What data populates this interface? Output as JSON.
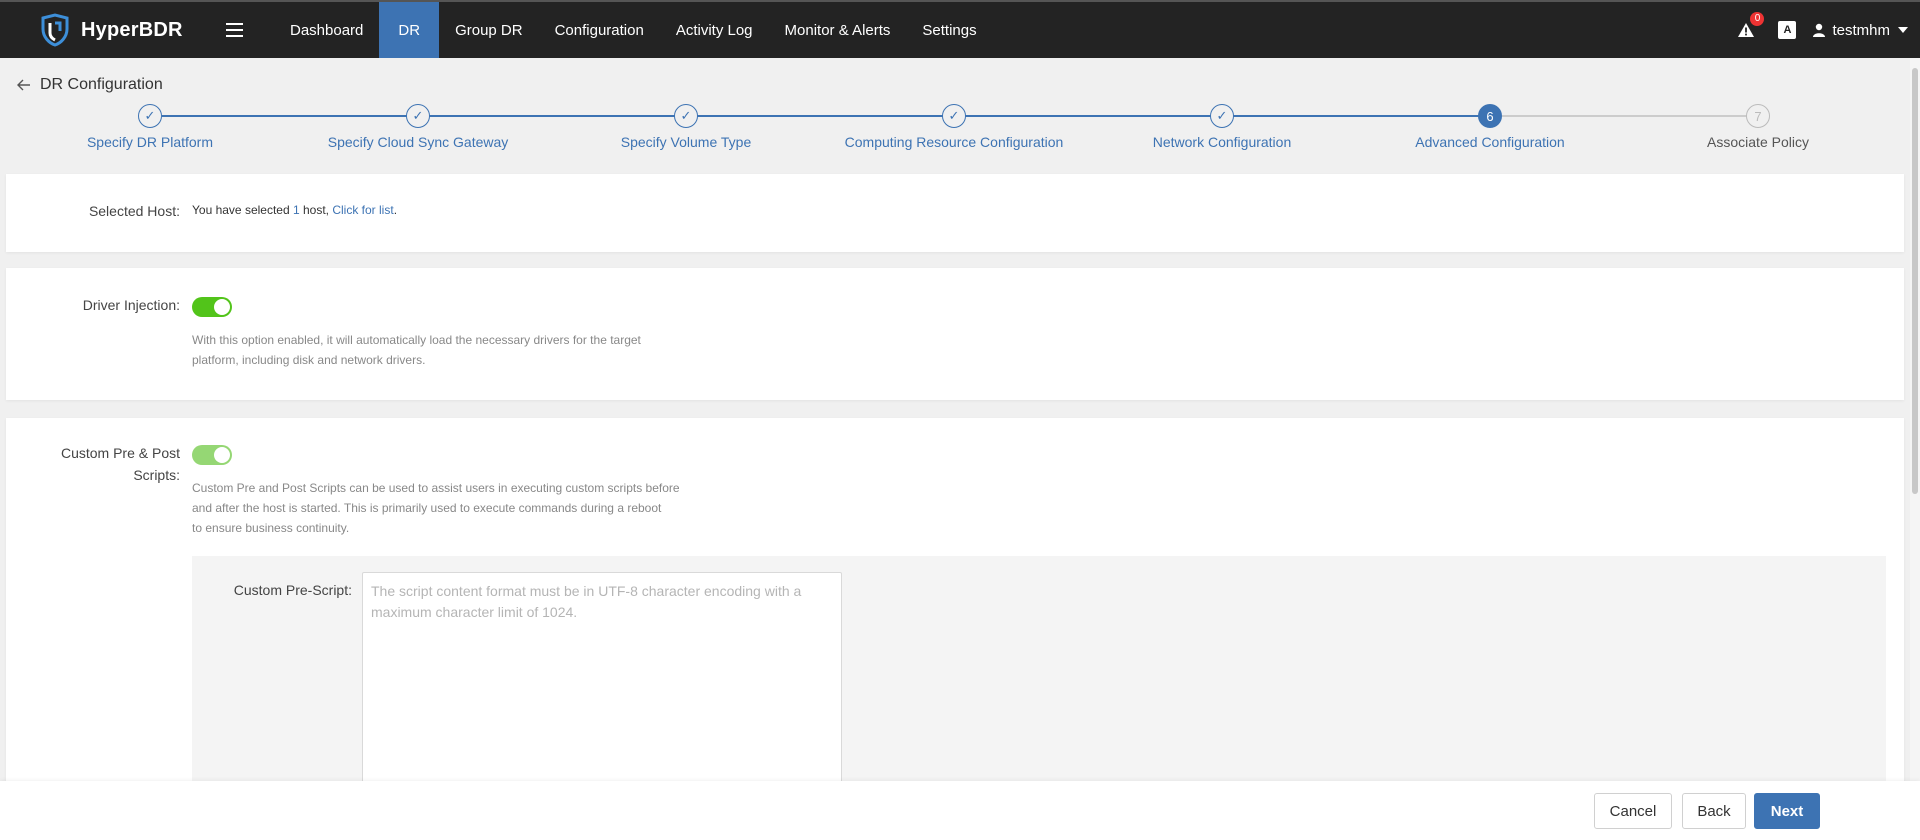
{
  "brand": {
    "name": "HyperBDR"
  },
  "nav": {
    "items": [
      {
        "label": "Dashboard",
        "active": false
      },
      {
        "label": "DR",
        "active": true
      },
      {
        "label": "Group DR",
        "active": false
      },
      {
        "label": "Configuration",
        "active": false
      },
      {
        "label": "Activity Log",
        "active": false
      },
      {
        "label": "Monitor & Alerts",
        "active": false
      },
      {
        "label": "Settings",
        "active": false
      }
    ],
    "alert_count": "0",
    "lang_icon": "A",
    "username": "testmhm"
  },
  "header": {
    "title": "DR Configuration"
  },
  "steps": [
    {
      "label": "Specify DR Platform",
      "state": "done",
      "marker": "✓"
    },
    {
      "label": "Specify Cloud Sync Gateway",
      "state": "done",
      "marker": "✓"
    },
    {
      "label": "Specify Volume Type",
      "state": "done",
      "marker": "✓"
    },
    {
      "label": "Computing Resource Configuration",
      "state": "done",
      "marker": "✓"
    },
    {
      "label": "Network Configuration",
      "state": "done",
      "marker": "✓"
    },
    {
      "label": "Advanced Configuration",
      "state": "current",
      "marker": "6"
    },
    {
      "label": "Associate Policy",
      "state": "todo",
      "marker": "7"
    }
  ],
  "selected_host": {
    "label": "Selected Host:",
    "prefix": "You have selected ",
    "count": "1",
    "suffix": " host, ",
    "link": "Click for list",
    "end": "."
  },
  "driver_injection": {
    "label": "Driver Injection:",
    "enabled": true,
    "desc_line1": "With this option enabled, it will automatically load the necessary drivers for the target",
    "desc_line2": "platform, including disk and network drivers."
  },
  "custom_scripts": {
    "label_line1": "Custom Pre & Post",
    "label_line2": "Scripts:",
    "enabled": true,
    "desc_line1": "Custom Pre and Post Scripts can be used to assist users in executing custom scripts before",
    "desc_line2": "and after the host is started. This is primarily used to execute commands during a reboot",
    "desc_line3": "to ensure business continuity.",
    "pre_script_label": "Custom Pre-Script:",
    "pre_script_placeholder": "The script content format must be in UTF-8 character encoding with a maximum character limit of 1024.",
    "pre_script_value": ""
  },
  "footer": {
    "cancel": "Cancel",
    "back": "Back",
    "next": "Next"
  },
  "colors": {
    "accent": "#3d73b3",
    "toggle_on": "#52c41a",
    "navbar": "#232323",
    "badge": "#e33333"
  }
}
